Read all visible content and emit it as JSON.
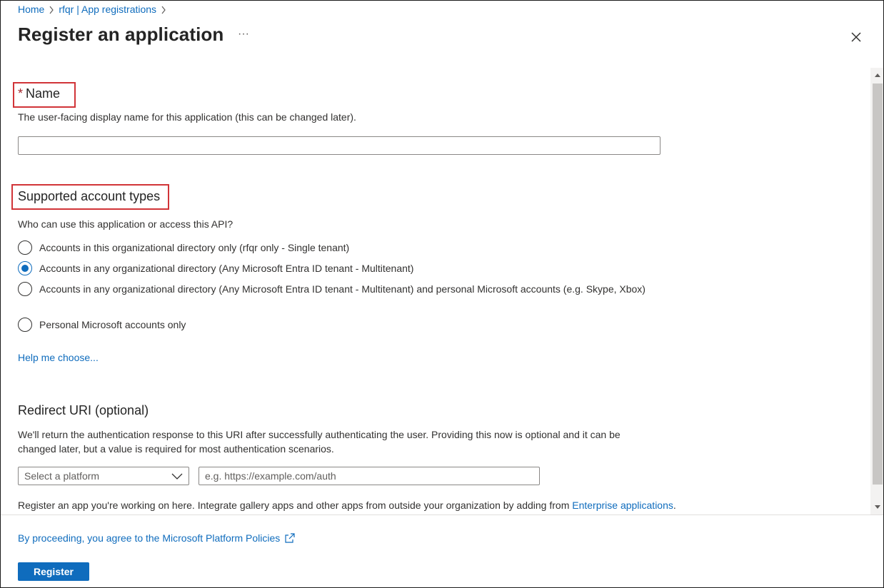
{
  "breadcrumb": {
    "items": [
      "Home",
      "rfqr | App registrations"
    ]
  },
  "header": {
    "title": "Register an application",
    "more_label": "···"
  },
  "name_section": {
    "required_mark": "*",
    "heading": "Name",
    "description": "The user-facing display name for this application (this can be changed later).",
    "input_value": ""
  },
  "account_types": {
    "heading": "Supported account types",
    "question": "Who can use this application or access this API?",
    "options": [
      "Accounts in this organizational directory only (rfqr only - Single tenant)",
      "Accounts in any organizational directory (Any Microsoft Entra ID tenant - Multitenant)",
      "Accounts in any organizational directory (Any Microsoft Entra ID tenant - Multitenant) and personal Microsoft accounts (e.g. Skype, Xbox)",
      "Personal Microsoft accounts only"
    ],
    "selected_index": 1,
    "help_link": "Help me choose..."
  },
  "redirect": {
    "heading": "Redirect URI (optional)",
    "description": "We'll return the authentication response to this URI after successfully authenticating the user. Providing this now is optional and it can be changed later, but a value is required for most authentication scenarios.",
    "platform_placeholder": "Select a platform",
    "uri_placeholder": "e.g. https://example.com/auth"
  },
  "bottom_note": {
    "text": "Register an app you're working on here. Integrate gallery apps and other apps from outside your organization by adding from ",
    "link": "Enterprise applications",
    "suffix": "."
  },
  "footer": {
    "policy_text": "By proceeding, you agree to the Microsoft Platform Policies",
    "register_label": "Register"
  },
  "colors": {
    "accent": "#0f6cbd",
    "highlight": "#d13438"
  },
  "icons": {
    "breadcrumb_separator": "chevron-right-icon",
    "close": "close-icon",
    "dropdown": "chevron-down-icon",
    "external": "external-link-icon"
  }
}
